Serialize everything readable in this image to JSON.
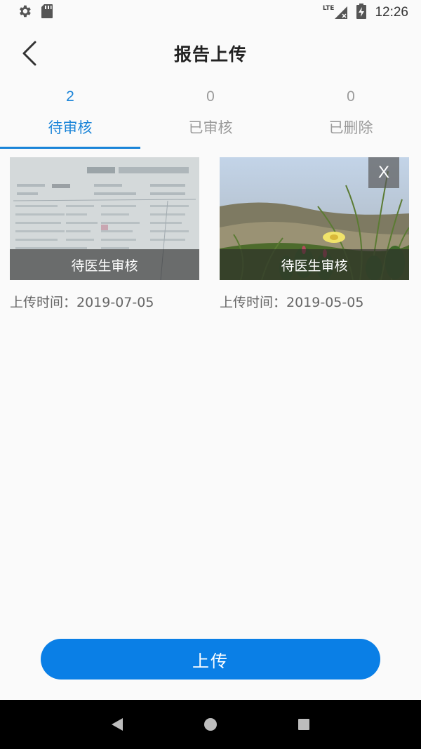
{
  "status_bar": {
    "time": "12:26",
    "network": "LTE",
    "icons": [
      "settings-icon",
      "sd-card-icon",
      "signal-icon",
      "battery-icon"
    ]
  },
  "header": {
    "title": "报告上传",
    "back_icon": "chevron-left-icon"
  },
  "tabs": [
    {
      "count": "2",
      "label": "待审核",
      "active": true
    },
    {
      "count": "0",
      "label": "已审核",
      "active": false
    },
    {
      "count": "0",
      "label": "已删除",
      "active": false
    }
  ],
  "cards": [
    {
      "status": "待医生审核",
      "upload_time": "上传时间：2019-07-05",
      "image": "document-photo",
      "deletable": false
    },
    {
      "status": "待医生审核",
      "upload_time": "上传时间：2019-05-05",
      "image": "nature-photo",
      "deletable": true,
      "delete_label": "X"
    }
  ],
  "upload_button": {
    "label": "上传"
  },
  "colors": {
    "accent": "#1a84d8",
    "button": "#0a7fe6",
    "background": "#fafafa",
    "nav_bar": "#000000"
  }
}
